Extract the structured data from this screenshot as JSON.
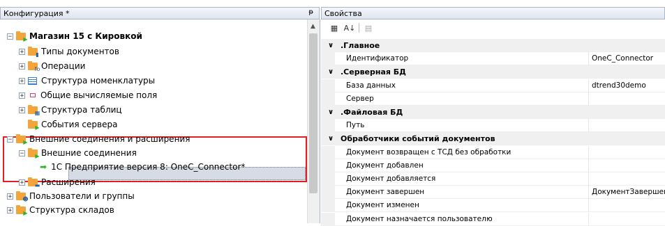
{
  "left_panel": {
    "title": "Конфигурация *",
    "pin_glyph": "ᵽ",
    "tree": [
      {
        "label": "Магазин 15 с Кировкой",
        "bold": true,
        "toggle": "−",
        "badge": "▶"
      },
      {
        "label": "Типы документов",
        "toggle": "+",
        "badge": "▮"
      },
      {
        "label": "Операции",
        "toggle": "+",
        "badge": "fo"
      },
      {
        "label": "Структура номенклатуры",
        "toggle": "+",
        "icon": "grid"
      },
      {
        "label": "Общие вычисляемые поля",
        "toggle": "+",
        "icon": "field"
      },
      {
        "label": "Структура таблиц",
        "toggle": "+",
        "badge": "▦"
      },
      {
        "label": "События сервера",
        "toggle": "",
        "badge": "▶"
      },
      {
        "label": "Внешние соединения и расширения",
        "toggle": "−",
        "badge": "▶"
      },
      {
        "label": "Внешние соединения",
        "toggle": "−",
        "badge": "▶"
      },
      {
        "label": "1С Предприятие версия 8: OneC_Connector*",
        "icon": "arrow"
      },
      {
        "label": "Расширения",
        "toggle": "+",
        "badge": "▬"
      },
      {
        "label": "Пользователи и группы",
        "toggle": "+",
        "badge": "☻"
      },
      {
        "label": "Структура складов",
        "toggle": "+",
        "badge": "▶"
      }
    ]
  },
  "right_panel": {
    "title": "Свойства",
    "toolbar": {
      "categorized": "▦",
      "sort": "A↓",
      "pages": "▤"
    },
    "rows": [
      {
        "type": "cat",
        "name": ".Главное"
      },
      {
        "type": "prop",
        "name": "Идентификатор",
        "value": "OneC_Connector"
      },
      {
        "type": "cat",
        "name": ".Серверная БД"
      },
      {
        "type": "prop",
        "name": "База данных",
        "value": "dtrend30demo"
      },
      {
        "type": "prop",
        "name": "Сервер",
        "value": ""
      },
      {
        "type": "cat",
        "name": ".Файловая БД"
      },
      {
        "type": "prop",
        "name": "Путь",
        "value": ""
      },
      {
        "type": "cat",
        "name": "Обработчики событий документов"
      },
      {
        "type": "prop",
        "name": "Документ возвращен с ТСД без обработки",
        "value": ""
      },
      {
        "type": "prop",
        "name": "Документ добавлен",
        "value": ""
      },
      {
        "type": "prop",
        "name": "Документ добавляется",
        "value": ""
      },
      {
        "type": "prop",
        "name": "Документ завершен",
        "value": "ДокументЗавершен"
      },
      {
        "type": "prop",
        "name": "Документ изменен",
        "value": ""
      },
      {
        "type": "prop",
        "name": "Документ назначается пользователю",
        "value": ""
      }
    ]
  },
  "colors": {
    "highlight": "#e01e23",
    "folder": "#f2a53a",
    "selection": "#d6dce6",
    "green_arrow": "#2bb52b"
  }
}
